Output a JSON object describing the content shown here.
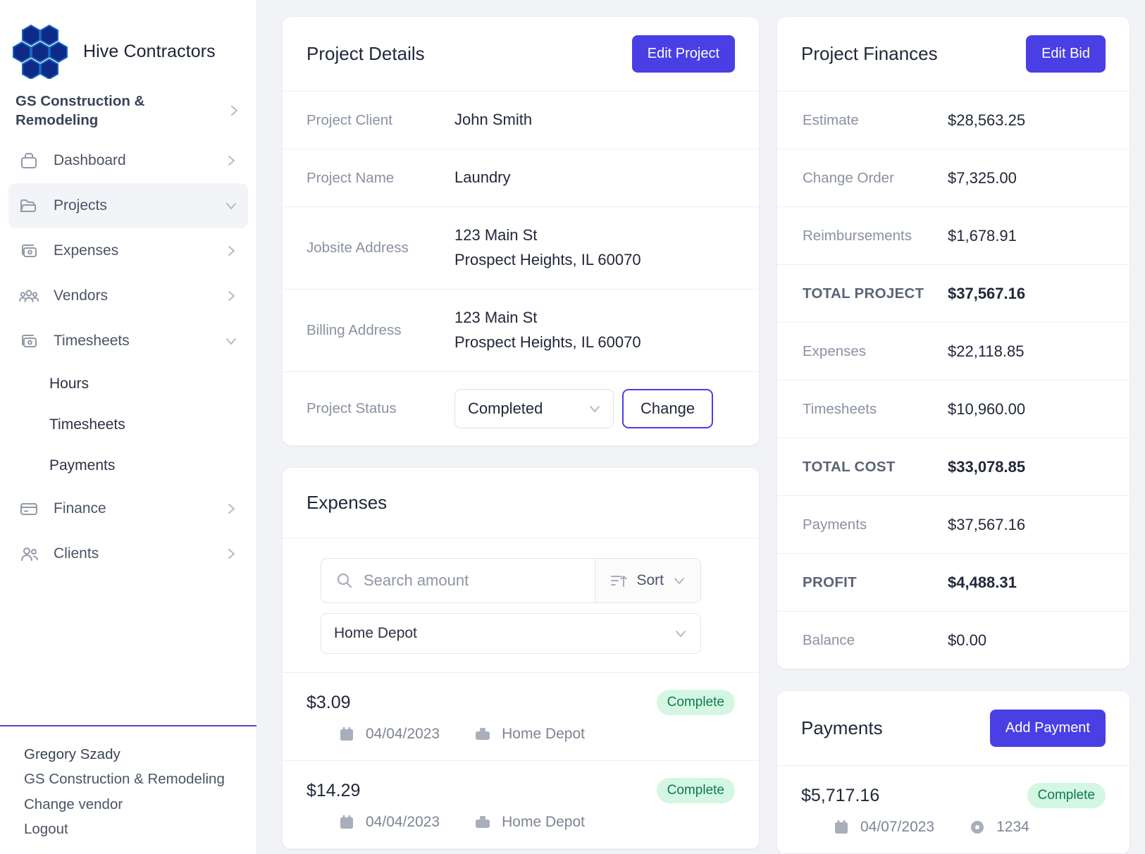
{
  "brand": {
    "name": "Hive Contractors",
    "logo_icon": "hexagon-honeycomb-logo"
  },
  "sidebar": {
    "org": {
      "label": "GS Construction & Remodeling",
      "chevron_icon": "chevron-right-icon"
    },
    "items": [
      {
        "label": "Dashboard",
        "icon": "briefcase-icon",
        "chevron": "chevron-right-icon",
        "active": false
      },
      {
        "label": "Projects",
        "icon": "folder-icon",
        "chevron": "chevron-down-icon",
        "active": true
      },
      {
        "label": "Expenses",
        "icon": "money-stack-icon",
        "chevron": "chevron-right-icon",
        "active": false
      },
      {
        "label": "Vendors",
        "icon": "people-group-icon",
        "chevron": "chevron-right-icon",
        "active": false
      },
      {
        "label": "Timesheets",
        "icon": "money-stack-icon",
        "chevron": "chevron-down-icon",
        "active": false
      }
    ],
    "sub_items": [
      {
        "label": "Hours"
      },
      {
        "label": "Timesheets"
      },
      {
        "label": "Payments"
      }
    ],
    "items_after": [
      {
        "label": "Finance",
        "icon": "credit-card-icon",
        "chevron": "chevron-right-icon",
        "active": false
      },
      {
        "label": "Clients",
        "icon": "people-icon",
        "chevron": "chevron-right-icon",
        "active": false
      }
    ],
    "footer": {
      "user_name": "Gregory Szady",
      "company": "GS Construction & Remodeling",
      "change_vendor": "Change vendor",
      "logout": "Logout"
    }
  },
  "project_details": {
    "title": "Project Details",
    "edit_button": "Edit Project",
    "rows": [
      {
        "label": "Project Client",
        "value": "John Smith"
      },
      {
        "label": "Project Name",
        "value": "Laundry"
      }
    ],
    "jobsite": {
      "label": "Jobsite Address",
      "line1": "123 Main St",
      "line2": "Prospect Heights, IL 60070"
    },
    "billing": {
      "label": "Billing Address",
      "line1": "123 Main St",
      "line2": "Prospect Heights, IL 60070"
    },
    "status": {
      "label": "Project Status",
      "value": "Completed",
      "change_button": "Change",
      "chevron_icon": "chevron-down-icon"
    }
  },
  "project_finances": {
    "title": "Project Finances",
    "edit_button": "Edit Bid",
    "rows": [
      {
        "label": "Estimate",
        "value": "$28,563.25",
        "total": false
      },
      {
        "label": "Change Order",
        "value": "$7,325.00",
        "total": false
      },
      {
        "label": "Reimbursements",
        "value": "$1,678.91",
        "total": false
      },
      {
        "label": "TOTAL PROJECT",
        "value": "$37,567.16",
        "total": true
      },
      {
        "label": "Expenses",
        "value": "$22,118.85",
        "total": false
      },
      {
        "label": "Timesheets",
        "value": "$10,960.00",
        "total": false
      },
      {
        "label": "TOTAL COST",
        "value": "$33,078.85",
        "total": true
      },
      {
        "label": "Payments",
        "value": "$37,567.16",
        "total": false
      },
      {
        "label": "PROFIT",
        "value": "$4,488.31",
        "total": true
      },
      {
        "label": "Balance",
        "value": "$0.00",
        "total": false
      }
    ]
  },
  "expenses": {
    "title": "Expenses",
    "search_placeholder": "Search amount",
    "search_value": "",
    "search_icon": "search-icon",
    "sort_label": "Sort",
    "sort_icon": "sort-icon",
    "sort_chevron": "chevron-down-icon",
    "vendor_filter": "Home Depot",
    "vendor_chevron": "chevron-down-icon",
    "rows": [
      {
        "amount": "$3.09",
        "status": "Complete",
        "date": "04/04/2023",
        "vendor": "Home Depot",
        "date_icon": "calendar-icon",
        "vendor_icon": "briefcase-icon"
      },
      {
        "amount": "$14.29",
        "status": "Complete",
        "date": "04/04/2023",
        "vendor": "Home Depot",
        "date_icon": "calendar-icon",
        "vendor_icon": "briefcase-icon"
      }
    ]
  },
  "payments": {
    "title": "Payments",
    "add_button": "Add Payment",
    "rows": [
      {
        "amount": "$5,717.16",
        "status": "Complete",
        "date": "04/07/2023",
        "reference": "1234",
        "date_icon": "calendar-icon",
        "ref_icon": "coin-icon"
      }
    ]
  },
  "colors": {
    "accent": "#4a3fe4",
    "badge_bg": "#d3f7e2",
    "badge_text": "#0f7a4f",
    "page_bg": "#f1f3f6"
  }
}
